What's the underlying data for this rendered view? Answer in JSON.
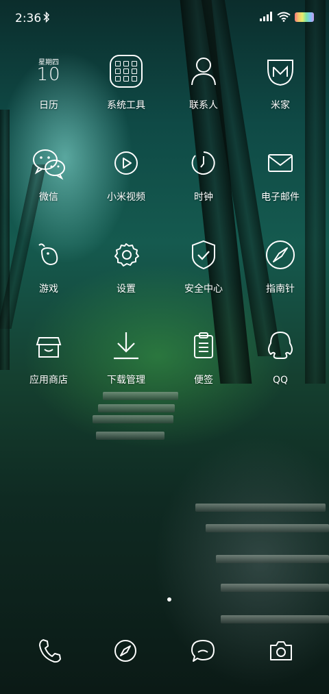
{
  "status_bar": {
    "time": "2:36",
    "icons": [
      "bluetooth-icon",
      "signal-icon",
      "wifi-icon",
      "battery-icon"
    ]
  },
  "apps": {
    "calendar": {
      "weekday": "星期四",
      "day": "10",
      "label": "日历",
      "icon": "calendar-icon"
    },
    "system_tools": {
      "label": "系统工具",
      "icon": "folder-icon"
    },
    "contacts": {
      "label": "联系人",
      "icon": "person-icon"
    },
    "mijia": {
      "label": "米家",
      "icon": "mijia-icon"
    },
    "wechat": {
      "label": "微信",
      "icon": "wechat-icon"
    },
    "mi_video": {
      "label": "小米视频",
      "icon": "play-icon"
    },
    "clock": {
      "label": "时钟",
      "icon": "clock-icon"
    },
    "email": {
      "label": "电子邮件",
      "icon": "mail-icon"
    },
    "games": {
      "label": "游戏",
      "icon": "gamepad-icon"
    },
    "settings": {
      "label": "设置",
      "icon": "gear-icon"
    },
    "security": {
      "label": "安全中心",
      "icon": "shield-icon"
    },
    "compass": {
      "label": "指南针",
      "icon": "compass-icon"
    },
    "app_store": {
      "label": "应用商店",
      "icon": "store-icon"
    },
    "downloads": {
      "label": "下载管理",
      "icon": "download-icon"
    },
    "notes": {
      "label": "便签",
      "icon": "notes-icon"
    },
    "qq": {
      "label": "QQ",
      "icon": "qq-icon"
    }
  },
  "page_indicator": {
    "pages": 1,
    "current": 1
  },
  "dock": [
    "phone-icon",
    "browser-icon",
    "messages-icon",
    "camera-icon"
  ],
  "colors": {
    "wallpaper_dark": "#0b2d2c",
    "wallpaper_mid": "#155a4f",
    "foliage": "#153f2f"
  }
}
